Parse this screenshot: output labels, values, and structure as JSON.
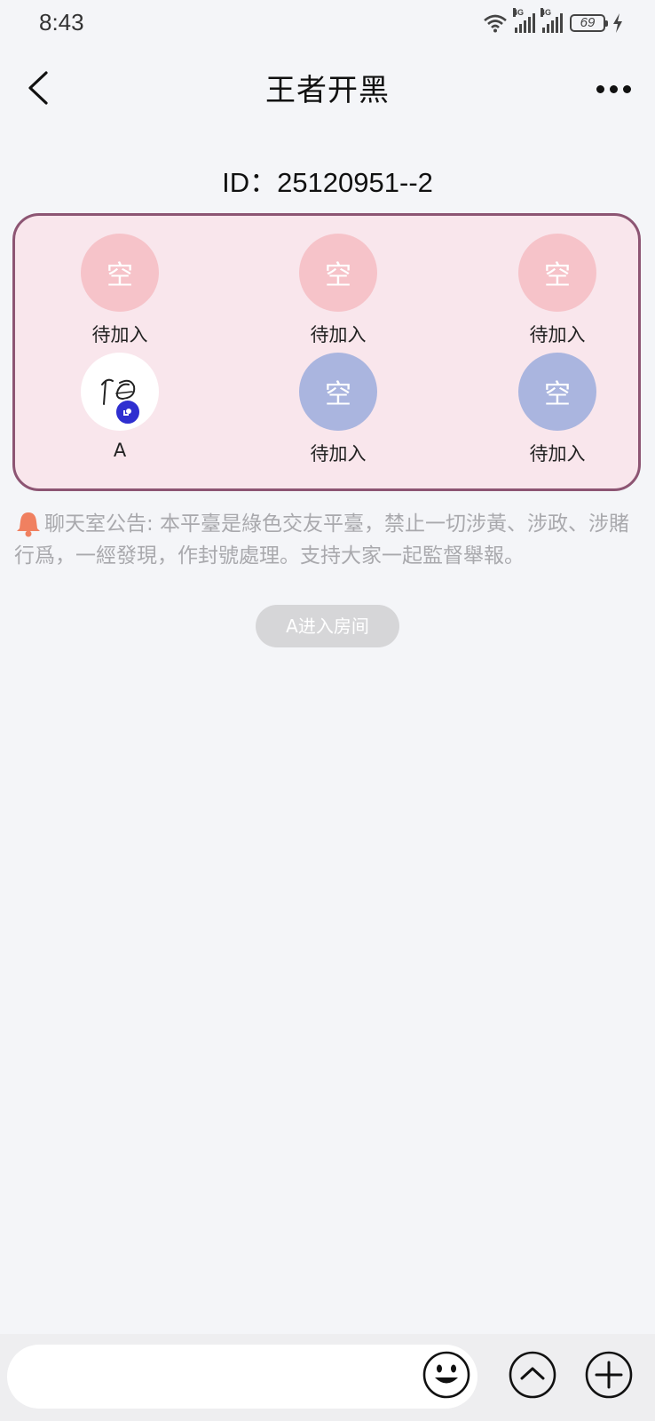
{
  "status_bar": {
    "time": "8:43",
    "network_1": "4G",
    "network_2": "4G",
    "battery": "69"
  },
  "header": {
    "title": "王者开黑",
    "back_icon": "chevron-left-icon",
    "more_icon": "more-horizontal-icon"
  },
  "room": {
    "id_text": "ID：25120951--2"
  },
  "seats": [
    {
      "glyph": "空",
      "label": "待加入",
      "color": "#f6c3c9"
    },
    {
      "glyph": "空",
      "label": "待加入",
      "color": "#f6c3c9"
    },
    {
      "glyph": "空",
      "label": "待加入",
      "color": "#f6c3c9"
    },
    {
      "glyph": "",
      "label": "A",
      "color": "#ffffff"
    },
    {
      "glyph": "空",
      "label": "待加入",
      "color": "#aab5df"
    },
    {
      "glyph": "空",
      "label": "待加入",
      "color": "#aab5df"
    }
  ],
  "notice": {
    "icon": "bell-icon",
    "text": "聊天室公告: 本平臺是綠色交友平臺，禁止一切涉黃、涉政、涉賭行爲，一經發現，作封號處理。支持大家一起監督舉報。"
  },
  "system_message": {
    "text": "A进入房间"
  },
  "composer": {
    "input_value": "",
    "emoji_icon": "emoji-icon",
    "up_icon": "chevron-up-circle-icon",
    "plus_icon": "plus-circle-icon"
  },
  "colors": {
    "panel_background": "#f9e6ec",
    "panel_border": "#8d5573",
    "seat_pink": "#f6c3c9",
    "seat_blue": "#aab5df",
    "mic_badge": "#2f2fd0",
    "notice_bell": "#f08060"
  }
}
